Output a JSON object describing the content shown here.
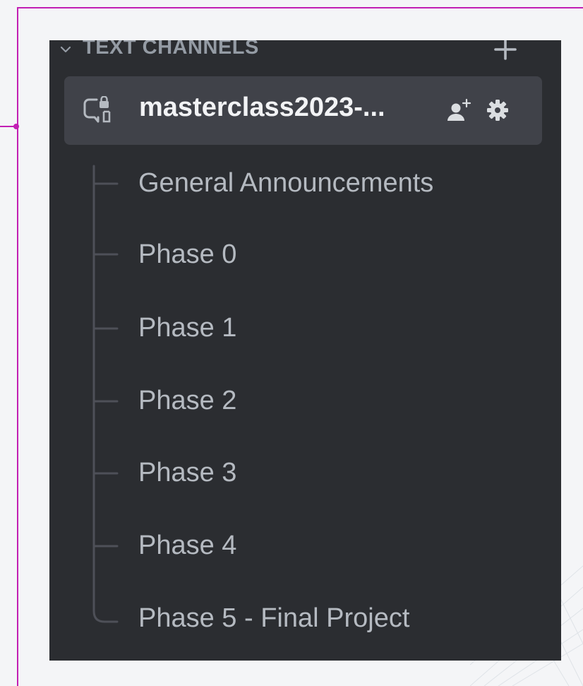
{
  "category": {
    "label": "TEXT CHANNELS",
    "chevron_icon": "chevron-down-icon",
    "add_icon": "plus-icon"
  },
  "channel": {
    "name": "masterclass2023-...",
    "icon": "thread-lock-icon",
    "invite_icon": "add-member-icon",
    "settings_icon": "gear-icon",
    "selected": true
  },
  "threads": [
    {
      "label": "General Announcements"
    },
    {
      "label": "Phase 0"
    },
    {
      "label": "Phase 1"
    },
    {
      "label": "Phase 2"
    },
    {
      "label": "Phase 3"
    },
    {
      "label": "Phase 4"
    },
    {
      "label": "Phase 5 - Final Project"
    }
  ],
  "colors": {
    "sidebar_bg": "#2b2d31",
    "selected_bg": "#404249",
    "channel_text": "#f2f3f5",
    "thread_text": "#b5bac1",
    "category_text": "#949ba4",
    "frame_accent": "#c21fb4"
  }
}
